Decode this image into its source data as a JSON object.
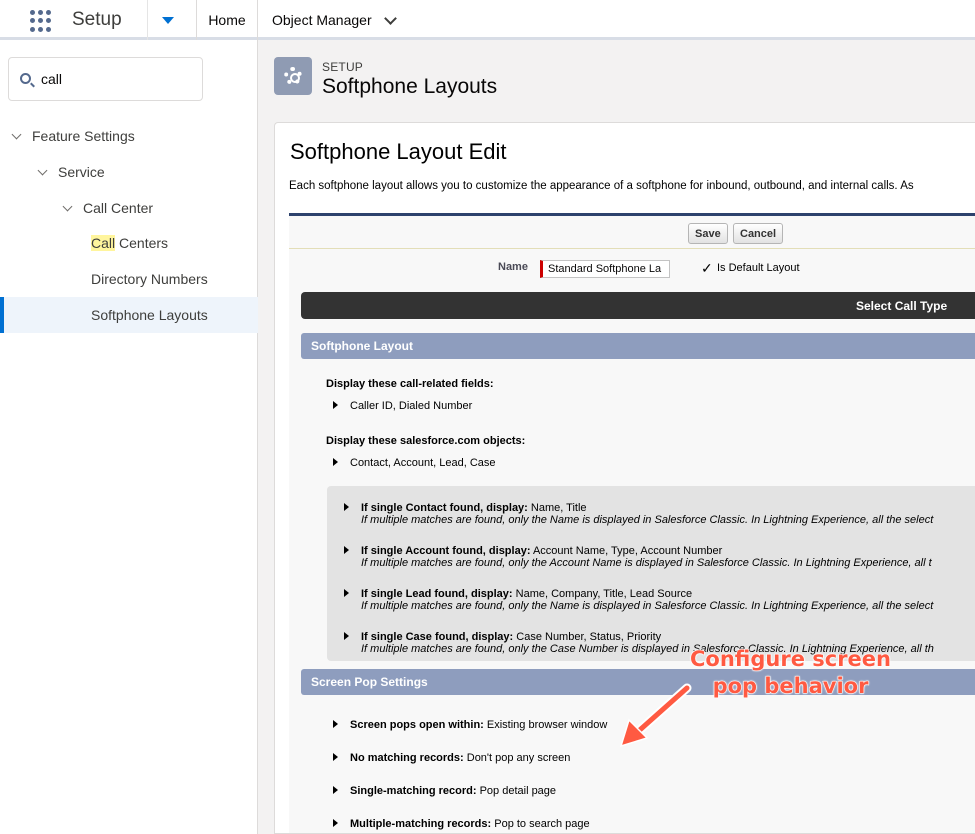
{
  "topbar": {
    "app_name": "Setup",
    "tabs": [
      {
        "label": "Home"
      },
      {
        "label": "Object Manager"
      }
    ]
  },
  "sidebar": {
    "search": {
      "value": "call"
    },
    "tree": [
      {
        "label": "Feature Settings"
      },
      {
        "label": "Service"
      },
      {
        "label": "Call Center"
      },
      {
        "label_hl": "Call",
        "label_rest": " Centers"
      },
      {
        "label": "Directory Numbers"
      },
      {
        "label": "Softphone Layouts"
      }
    ]
  },
  "header": {
    "kicker": "SETUP",
    "title": "Softphone Layouts"
  },
  "page": {
    "title": "Softphone Layout Edit",
    "description": "Each softphone layout allows you to customize the appearance of a softphone for inbound, outbound, and internal calls. As",
    "buttons": {
      "save": "Save",
      "cancel": "Cancel"
    },
    "name_label": "Name",
    "name_value": "Standard Softphone La",
    "default_checkmark": "✓",
    "default_label": "Is Default Layout",
    "select_call_type": "Select Call Type"
  },
  "softphone_layout": {
    "header": "Softphone Layout",
    "fields_label": "Display these call-related fields:",
    "fields_value": "Caller ID, Dialed Number",
    "objects_label": "Display these salesforce.com objects:",
    "objects_value": "Contact, Account, Lead, Case",
    "objects": [
      {
        "bold": "If single Contact found, display:",
        "value": " Name, Title",
        "note": "If multiple matches are found, only the Name is displayed in Salesforce Classic. In Lightning Experience, all the select"
      },
      {
        "bold": "If single Account found, display:",
        "value": " Account Name, Type, Account Number",
        "note": "If multiple matches are found, only the Account Name is displayed in Salesforce Classic. In Lightning Experience, all t"
      },
      {
        "bold": "If single Lead found, display:",
        "value": " Name, Company, Title, Lead Source",
        "note": "If multiple matches are found, only the Name is displayed in Salesforce Classic. In Lightning Experience, all the select"
      },
      {
        "bold": "If single Case found, display:",
        "value": " Case Number, Status, Priority",
        "note": "If multiple matches are found, only the Case Number is displayed in Salesforce Classic. In Lightning Experience, all th"
      }
    ]
  },
  "screen_pop": {
    "header": "Screen Pop Settings",
    "rows": [
      {
        "bold": "Screen pops open within:",
        "value": " Existing browser window"
      },
      {
        "bold": "No matching records:",
        "value": " Don't pop any screen"
      },
      {
        "bold": "Single-matching record:",
        "value": " Pop detail page"
      },
      {
        "bold": "Multiple-matching records:",
        "value": " Pop to search page"
      }
    ]
  },
  "annotation": {
    "line1": "Configure screen",
    "line2": "pop behavior",
    "color": "#ff5a42"
  }
}
